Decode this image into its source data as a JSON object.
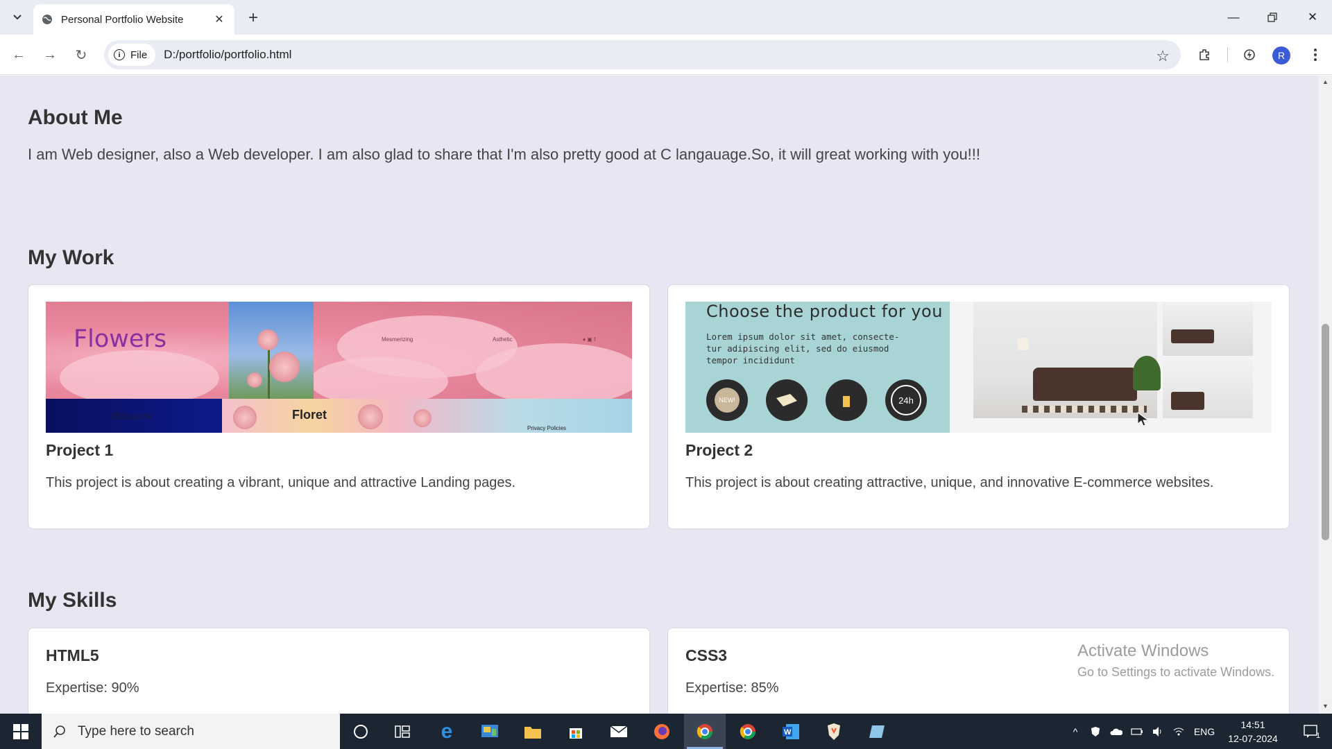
{
  "browser": {
    "tab_title": "Personal Portfolio Website",
    "address_chip": "File",
    "url": "D:/portfolio/portfolio.html",
    "profile_initial": "R"
  },
  "page": {
    "about": {
      "title": "About Me",
      "text": "I am Web designer, also a Web developer. I am also glad to share that I'm also pretty good at C langauage.So, it will great working with you!!!"
    },
    "work": {
      "title": "My Work",
      "projects": [
        {
          "title": "Project 1",
          "description": "This project is about creating a vibrant, unique and attractive Landing pages.",
          "image_text": {
            "title": "Flowers",
            "nav1": "Mesmerizing",
            "nav2": "Asthetic",
            "social": "♦ ▣ f",
            "label1": "Blossom",
            "label2": "Floret",
            "footer": "Privacy Policies"
          }
        },
        {
          "title": "Project 2",
          "description": "This project is about creating attractive, unique, and innovative E-commerce websites.",
          "image_text": {
            "heading": "Choose the product for you",
            "body": "Lorem ipsum dolor sit amet, consecte- tur adipiscing elit, sed do eiusmod tempor incididunt",
            "badge_new": "NEW!",
            "badge_24h": "24h"
          }
        }
      ]
    },
    "skills": {
      "title": "My Skills",
      "items": [
        {
          "name": "HTML5",
          "expertise": "Expertise: 90%",
          "level": 0.9
        },
        {
          "name": "CSS3",
          "expertise": "Expertise: 85%",
          "level": 0.85
        }
      ]
    }
  },
  "watermark": {
    "line1": "Activate Windows",
    "line2": "Go to Settings to activate Windows."
  },
  "taskbar": {
    "search_placeholder": "Type here to search",
    "language": "ENG",
    "time": "14:51",
    "date": "12-07-2024",
    "notification_count": "1"
  },
  "colors": {
    "page_background": "#e8e6f2",
    "heading": "#333333",
    "taskbar": "#1c2633",
    "profile": "#3b5bd6"
  }
}
